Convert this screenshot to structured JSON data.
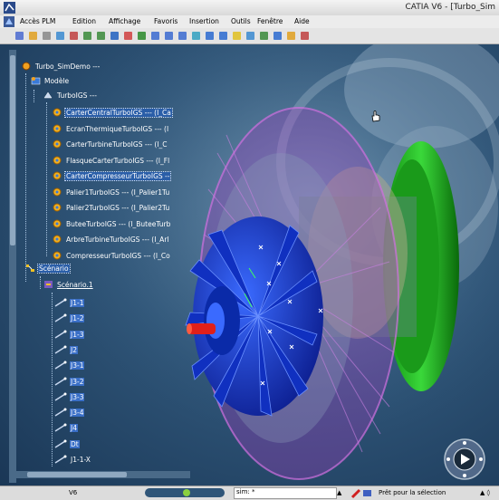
{
  "window": {
    "title": "CATIA V6 - [Turbo_Sim",
    "menu": [
      "Accès PLM",
      "Edition",
      "Affichage",
      "Favoris",
      "Insertion",
      "Outils",
      "Fenêtre",
      "Aide"
    ]
  },
  "toolbar": {
    "icons": [
      "new-icon",
      "open-icon",
      "cut-icon",
      "copy-icon",
      "paste-icon",
      "undo-icon",
      "redo-icon",
      "help-icon",
      "fit-all-icon",
      "pan-icon",
      "rotate-icon",
      "zoom-in-icon",
      "zoom-out-icon",
      "normal-view-icon",
      "multi-view-icon",
      "iso-view-icon",
      "shading-icon",
      "hide-show-icon",
      "swap-icon",
      "image-icon",
      "measure-icon",
      "publish-icon"
    ]
  },
  "tree": {
    "root": "Turbo_SimDemo ---",
    "modele": "Modèle",
    "product": "TurboIGS ---",
    "parts": [
      "CarterCentralTurboIGS --- (I_Ca",
      "EcranThermiqueTurboIGS --- (I",
      "CarterTurbineTurboIGS --- (I_C",
      "FlasqueCarterTurboIGS --- (I_Fl",
      "CarterCompresseurTurboIGS --",
      "Palier1TurboIGS --- (I_Palier1Tu",
      "Palier2TurboIGS --- (I_Palier2Tu",
      "ButeeTurboIGS --- (I_ButeeTurb",
      "ArbreTurbineTurboIGS --- (I_Arl",
      "CompresseurTurboIGS --- (I_Co"
    ],
    "scenario": "Scénario",
    "scenario_item": "Scénario.1",
    "steps": [
      "J1-1",
      "J1-2",
      "J1-3",
      "J2",
      "J3-1",
      "J3-2",
      "J3-3",
      "J3-4",
      "J4",
      "Dt",
      "J1-1-X"
    ]
  },
  "status": {
    "left": "V6",
    "command": "sim: *",
    "message": "Prêt pour la sélection",
    "right": "▲ ◊"
  },
  "colors": {
    "accent": "#2a5ea8",
    "flange_green": "#22c020",
    "impeller_blue": "#1a3fd8",
    "shaft_red": "#e0201a",
    "casing_magenta": "#c060d0"
  }
}
